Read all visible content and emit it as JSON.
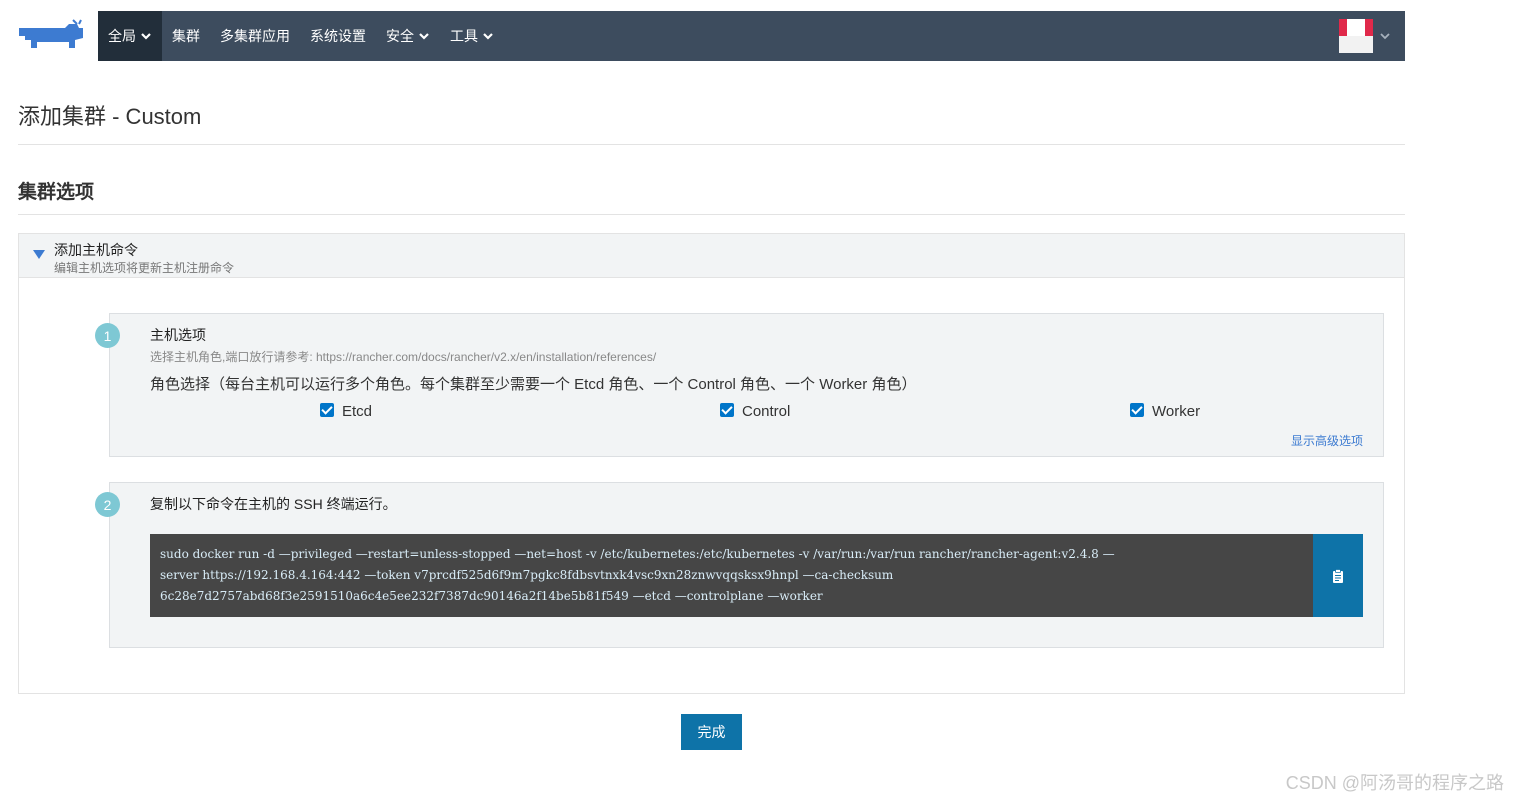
{
  "nav": {
    "items": [
      {
        "label": "全局",
        "has_dropdown": true,
        "active": true
      },
      {
        "label": "集群",
        "has_dropdown": false,
        "active": false
      },
      {
        "label": "多集群应用",
        "has_dropdown": false,
        "active": false
      },
      {
        "label": "系统设置",
        "has_dropdown": false,
        "active": false
      },
      {
        "label": "安全",
        "has_dropdown": true,
        "active": false
      },
      {
        "label": "工具",
        "has_dropdown": true,
        "active": false
      }
    ],
    "logo_icon": "rancher-cow-logo",
    "user_icon": "user-avatar"
  },
  "page": {
    "title": "添加集群 - Custom",
    "section_title": "集群选项"
  },
  "accordion": {
    "title": "添加主机命令",
    "subtitle": "编辑主机选项将更新主机注册命令"
  },
  "step1": {
    "number": "1",
    "title": "主机选项",
    "help": "选择主机角色,端口放行请参考: https://rancher.com/docs/rancher/v2.x/en/installation/references/",
    "role_text": "角色选择（每台主机可以运行多个角色。每个集群至少需要一个 Etcd 角色、一个 Control 角色、一个 Worker 角色）",
    "roles": [
      {
        "label": "Etcd",
        "checked": true
      },
      {
        "label": "Control",
        "checked": true
      },
      {
        "label": "Worker",
        "checked": true
      }
    ],
    "advanced_link": "显示高级选项"
  },
  "step2": {
    "number": "2",
    "title": "复制以下命令在主机的 SSH 终端运行。",
    "command_lines": [
      "sudo docker run -d —privileged —restart=unless-stopped —net=host -v /etc/kubernetes:/etc/kubernetes -v /var/run:/var/run rancher/rancher-agent:v2.4.8 —",
      "server https://192.168.4.164:442 —token v7prcdf525d6f9m7pgkc8fdbsvtnxk4vsc9xn28znwvqqsksx9hnpl —ca-checksum",
      "6c28e7d2757abd68f3e2591510a6c4e5ee232f7387dc90146a2f14be5b81f549 —etcd —controlplane —worker"
    ],
    "copy_icon": "clipboard-icon"
  },
  "footer": {
    "done_label": "完成"
  },
  "watermark": "CSDN @阿汤哥的程序之路",
  "colors": {
    "nav_bg": "#3d4c5e",
    "nav_active_bg": "#222e3a",
    "primary": "#0e73a8",
    "step_badge": "#7ec8d4",
    "command_bg": "#464646",
    "link": "#3d7bd1"
  }
}
